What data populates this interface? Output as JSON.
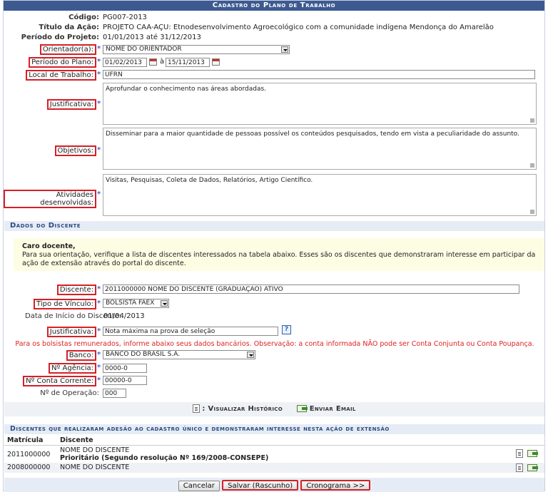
{
  "title": "Cadastro do Plano de Trabalho",
  "info": {
    "codigo_label": "Código:",
    "codigo": "PG007-2013",
    "titulo_label": "Título da Ação:",
    "titulo": "PROJETO CAA-AÇU: Etnodesenvolvimento Agroecológico com a comunidade indígena Mendonça do Amarelão",
    "periodo_projeto_label": "Período do Projeto:",
    "periodo_projeto": "01/01/2013 até 31/12/2013"
  },
  "plano": {
    "orientador_label": "Orientador(a):",
    "orientador": "NOME DO ORIENTADOR",
    "periodo_label": "Período do Plano:",
    "periodo_inicio": "01/02/2013",
    "periodo_sep": "à",
    "periodo_fim": "15/11/2013",
    "local_label": "Local de Trabalho:",
    "local": "UFRN",
    "justificativa_label": "Justificativa:",
    "justificativa": "Aprofundar o conhecimento nas áreas abordadas.",
    "objetivos_label": "Objetivos:",
    "objetivos": "Disseminar para a maior quantidade de pessoas possível os conteúdos pesquisados, tendo em vista a peculiaridade do assunto.",
    "atividades_label": "Atividades desenvolvidas:",
    "atividades": "Visitas, Pesquisas, Coleta de Dados, Relatórios, Artigo Científico."
  },
  "discente_section": {
    "heading": "Dados do Discente",
    "notice_title": "Caro docente,",
    "notice_text": "Para sua orientação, verifique a lista de discentes interessados na tabela abaixo. Esses são os discentes que demonstraram interesse em participar da ação de extensão através do portal do discente.",
    "discente_label": "Discente:",
    "discente": "2011000000 NOME DO DISCENTE (GRADUAÇÃO) ATIVO",
    "vinculo_label": "Tipo de Vínculo:",
    "vinculo": "BOLSISTA FAEX",
    "data_inicio_label": "Data de Início do Discente:",
    "data_inicio": "01/04/2013",
    "justificativa_label": "Justificativa:",
    "justificativa": "Nota máxima na prova de seleção",
    "warning": "Para os bolsistas remunerados, informe abaixo seus dados bancários. Observação: a conta informada NÃO pode ser Conta Conjunta ou Conta Poupança.",
    "banco_label": "Banco:",
    "banco": "BANCO DO BRASIL S.A.",
    "agencia_label": "Nº Agência:",
    "agencia": "0000-0",
    "conta_label": "Nº Conta Corrente:",
    "conta": "00000-0",
    "operacao_label": "Nº de Operação:",
    "operacao": "000"
  },
  "actions": {
    "historico": "Visualizar Histórico",
    "email": "Enviar Email",
    "historico_sep": ":"
  },
  "list": {
    "heading": "Discentes que realizaram adesão ao cadastro único e demonstraram interesse nesta ação de extensão",
    "col_matricula": "Matrícula",
    "col_discente": "Discente",
    "rows": [
      {
        "matricula": "2011000000",
        "nome": "NOME DO DISCENTE",
        "extra": "Prioritário (Segundo resolução Nº 169/2008-CONSEPE)"
      },
      {
        "matricula": "2008000000",
        "nome": "NOME DO DISCENTE",
        "extra": ""
      }
    ]
  },
  "buttons": {
    "cancelar": "Cancelar",
    "salvar": "Salvar (Rascunho)",
    "cronograma": "Cronograma >>"
  },
  "colors": {
    "title_bg": "#3c5a90",
    "highlight": "#d71f26",
    "required_star": "#3b6bd6",
    "warning": "#dd2222"
  }
}
